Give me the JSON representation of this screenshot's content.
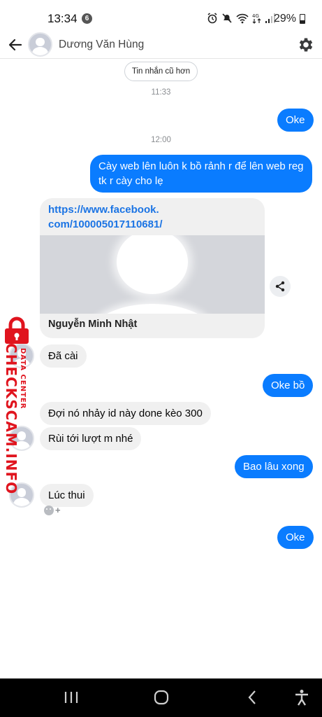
{
  "status_bar": {
    "time": "13:34",
    "notification_count": "6",
    "battery": "29%"
  },
  "header": {
    "contact_name": "Dương Văn Hùng"
  },
  "chat": {
    "older_messages_label": "Tin nhắn cũ hơn",
    "timestamp_1": "11:33",
    "timestamp_2": "12:00",
    "msg_oke_1": "Oke",
    "msg_out_2_line1": "Cày web lên luôn k bồ rảnh r để lên web reg",
    "msg_out_2_line2": "tk r cày cho lẹ",
    "link_url_line1": "https://www.facebook.",
    "link_url_line2": "com/100005017110681/",
    "link_title": "Nguyễn Minh Nhật",
    "msg_in_1": "Đã cài",
    "msg_out_3": "Oke bồ",
    "msg_in_2": "Đợi nó nhảy id này done kèo 300",
    "msg_in_3": "Rùi tới lượt m nhé",
    "msg_out_4": "Bao lâu xong",
    "msg_in_4": "Lúc thui",
    "msg_oke_2": "Oke"
  },
  "watermark": {
    "main": "CHECKSCAM.INFO",
    "sub": "DATA CENTER"
  },
  "icons": {
    "back": "arrow-left-icon",
    "settings": "gear-icon",
    "share": "share-icon",
    "nav_recents": "recents-icon",
    "nav_home": "home-icon",
    "nav_back": "back-icon",
    "nav_accessibility": "accessibility-icon"
  },
  "colors": {
    "outgoing_bubble": "#0a7cff",
    "incoming_bubble": "#f0f0f0",
    "link": "#1b74e4",
    "watermark": "#e0141e"
  }
}
